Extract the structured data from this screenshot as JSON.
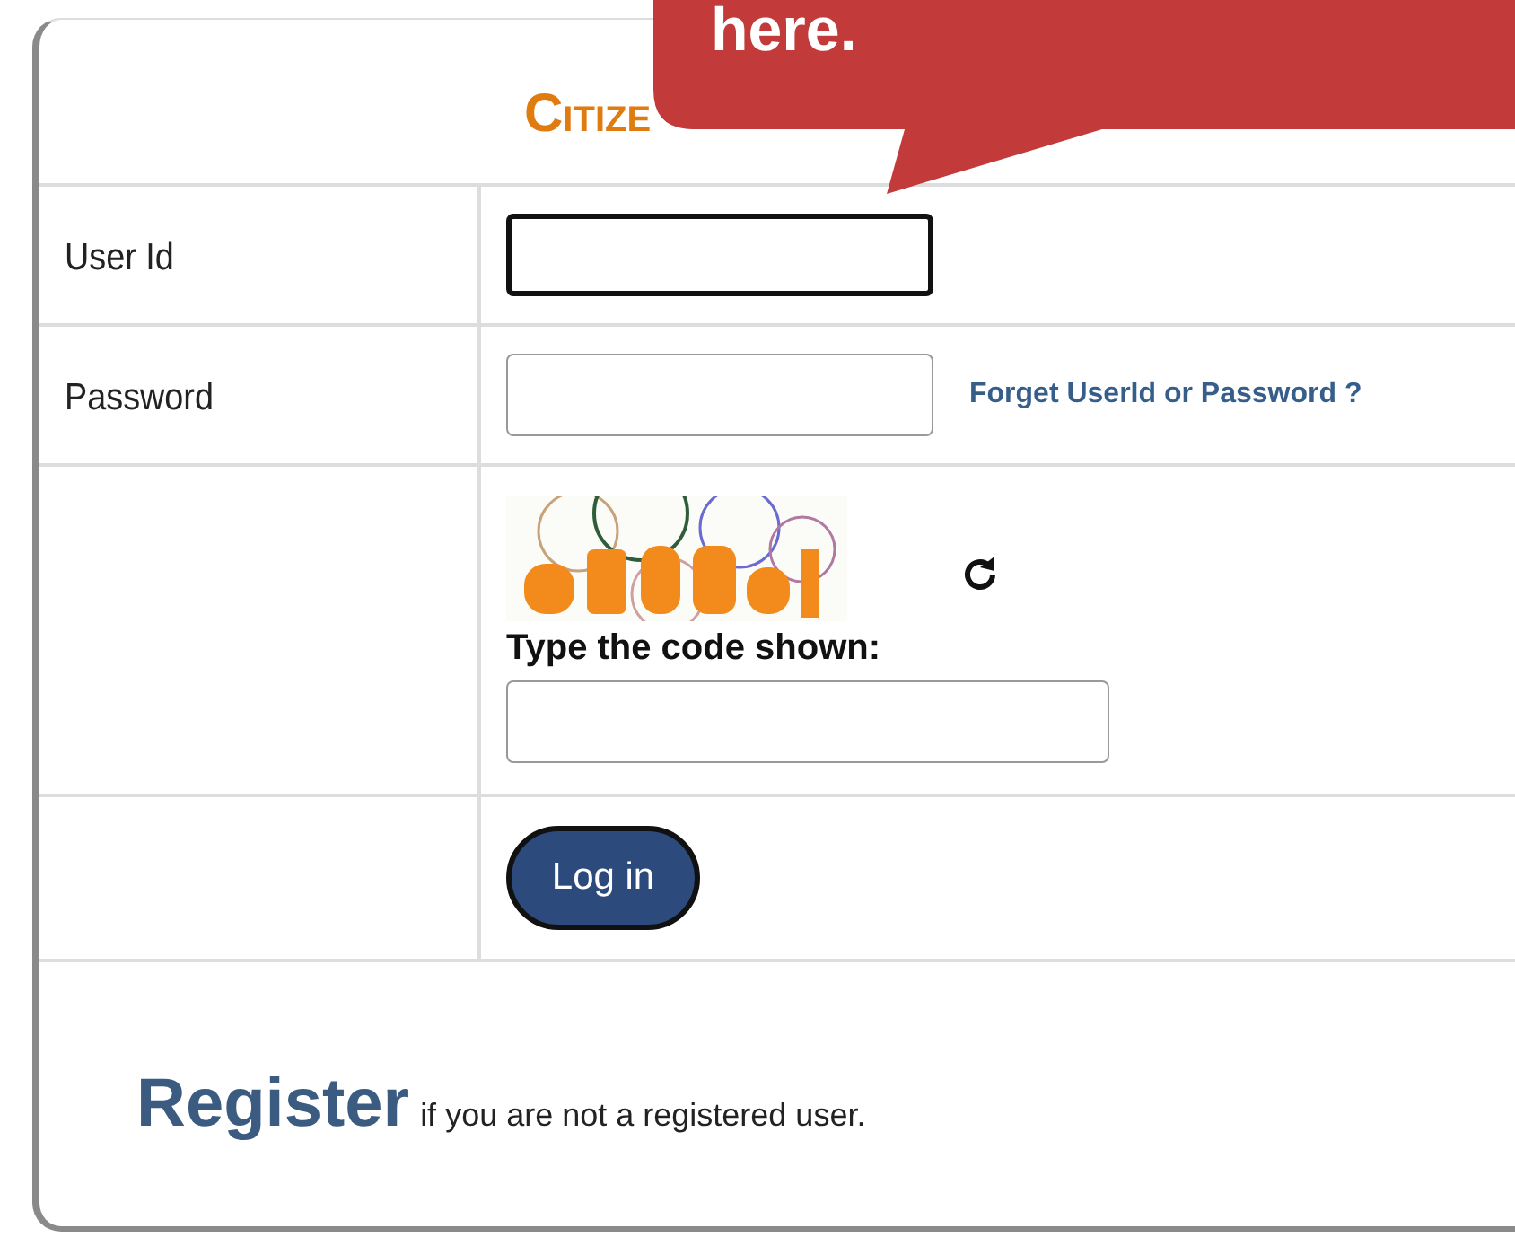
{
  "title": "CITIZE",
  "callout": {
    "text": "here."
  },
  "rows": [
    {
      "kind": "input",
      "label": "User Id",
      "focused": true
    },
    {
      "kind": "input",
      "label": "Password",
      "focused": false,
      "link": "Forget UserId or Password ?"
    },
    {
      "kind": "captcha",
      "prompt": "Type the code shown:"
    },
    {
      "kind": "button",
      "button": "Log in"
    }
  ],
  "register": {
    "link": "Register",
    "text": "if you are not a registered user."
  }
}
